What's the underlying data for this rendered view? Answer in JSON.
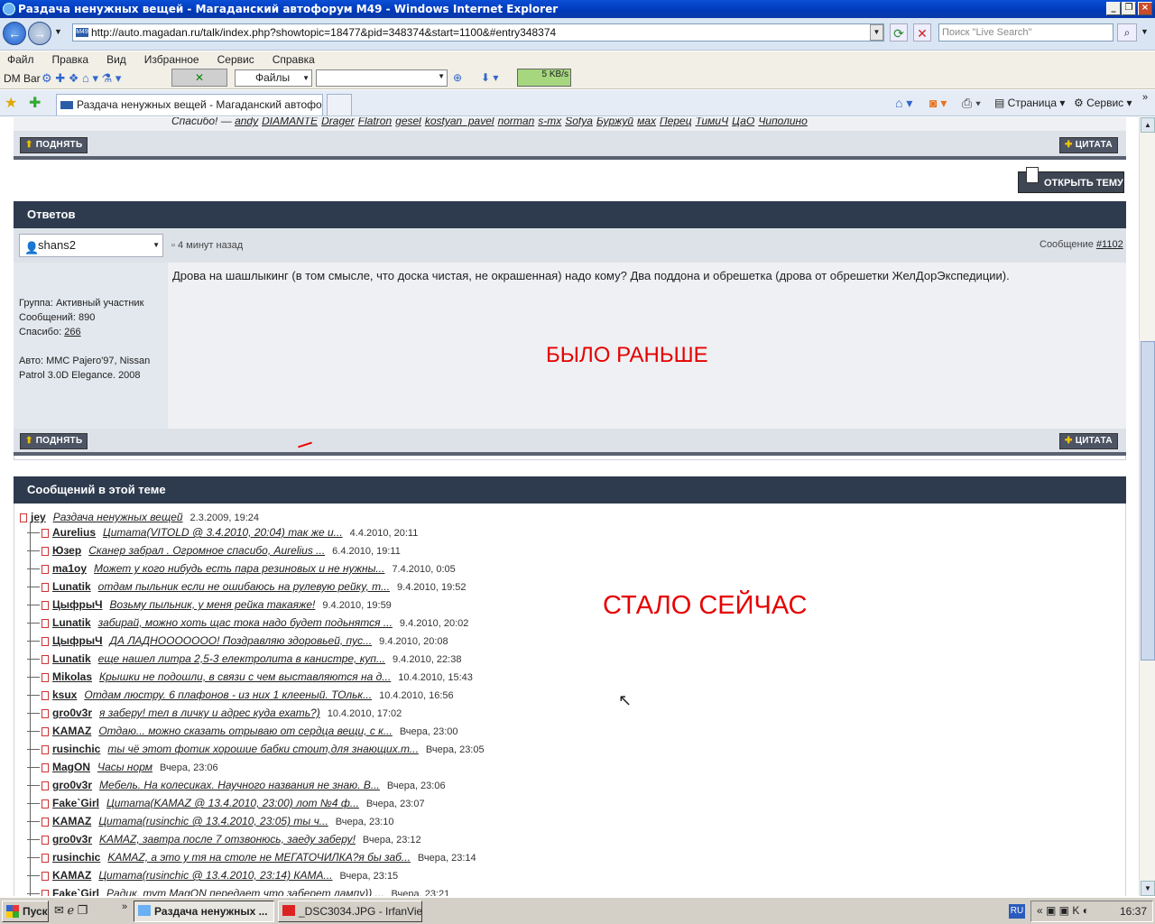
{
  "window": {
    "title": "Раздача ненужных вещей - Магаданский автофорум M49 - Windows Internet Explorer"
  },
  "address": {
    "url": "http://auto.magadan.ru/talk/index.php?showtopic=18477&pid=348374&start=1100&#entry348374",
    "favicon": "M49"
  },
  "search": {
    "placeholder": "Поиск \"Live Search\""
  },
  "menu": [
    "Файл",
    "Правка",
    "Вид",
    "Избранное",
    "Сервис",
    "Справка"
  ],
  "dmbar": {
    "label": "DM Bar",
    "files": "Файлы",
    "speed": "5 KB/s"
  },
  "tab": {
    "title": "Раздача ненужных вещей - Магаданский автофор..."
  },
  "cmdbar": {
    "page": "Страница",
    "service": "Сервис"
  },
  "thanks": {
    "prefix": "Спасибо! —",
    "users": [
      "andy",
      "DIAMANTE",
      "Drager",
      "Flatron",
      "gesel",
      "kostyan_pavel",
      "norman",
      "s-mx",
      "Sofya",
      "Буржуй",
      "мах",
      "Перец",
      "ТимиЧ",
      "ЦаО",
      "Чиполино"
    ]
  },
  "buttons": {
    "up": "ПОДНЯТЬ",
    "quote": "ЦИТАТА",
    "open_topic": "ОТКРЫТЬ ТЕМУ"
  },
  "reply_section": {
    "title": "Ответов"
  },
  "post": {
    "author": "shans2",
    "time": "4 минут назад",
    "msg_label": "Сообщение",
    "msg_num": "#1102",
    "group": "Группа: Активный участник",
    "messages": "Сообщений: 890",
    "thanks_label": "Спасибо:",
    "thanks_count": "266",
    "auto": "Авто: ММС Pajero'97, Nissan Patrol 3.0D Elegance. 2008",
    "text": "Дрова на шашлыкинг (в том смысле, что доска чистая, не окрашенная) надо кому? Два поддона и обрешетка (дрова от обрешетки ЖелДорЭкспедиции).",
    "annotation": "БЫЛО РАНЬШЕ"
  },
  "topic_section": {
    "title": "Сообщений в этой теме",
    "annotation": "СТАЛО СЕЙЧАС"
  },
  "root": {
    "author": "jey",
    "link": "Раздача ненужных вещей",
    "date": "2.3.2009, 19:24"
  },
  "topic_rows": [
    {
      "author": "Aurelius",
      "link": "Цитата(VITOLD @ 3.4.2010, 20:04) так же и...",
      "date": "4.4.2010, 20:11"
    },
    {
      "author": "Юзер",
      "link": "Сканер забрал . Огромное спасибо, Aurelius ...",
      "date": "6.4.2010, 19:11"
    },
    {
      "author": "ma1oy",
      "link": "Может у кого нибудь есть пара резиновых и не нужны...",
      "date": "7.4.2010, 0:05"
    },
    {
      "author": "Lunatik",
      "link": "отдам пыльник если не ошибаюсь на рулевую рейку, т...",
      "date": "9.4.2010, 19:52"
    },
    {
      "author": "ЦыфрыЧ",
      "link": "Возьму пыльник, у меня рейка такаяже!",
      "date": "9.4.2010, 19:59"
    },
    {
      "author": "Lunatik",
      "link": "забирай, можно хоть щас тока надо будет подьнятся ...",
      "date": "9.4.2010, 20:02"
    },
    {
      "author": "ЦыфрыЧ",
      "link": "ДА ЛАДНООООООО! Поздравляю здоровьей, пус...",
      "date": "9.4.2010, 20:08"
    },
    {
      "author": "Lunatik",
      "link": "еще нашел литра 2,5-3 електролита в канистре, куп...",
      "date": "9.4.2010, 22:38"
    },
    {
      "author": "Mikolas",
      "link": "Крышки не подошли, в связи с чем выставляются на д...",
      "date": "10.4.2010, 15:43"
    },
    {
      "author": "ksux",
      "link": "Отдам люстру. 6 плафонов - из них 1 клееный. ТОльк...",
      "date": "10.4.2010, 16:56"
    },
    {
      "author": "gro0v3r",
      "link": "я заберу! тел в личку и адрес куда ехать?)",
      "date": "10.4.2010, 17:02"
    },
    {
      "author": "KAMAZ",
      "link": "Отдаю... можно сказать отрываю от сердца вещи, с к...",
      "date": "Вчера, 23:00"
    },
    {
      "author": "rusinchic",
      "link": "ты чё этот фотик хорошие бабки стоит,для знающих.т...",
      "date": "Вчера, 23:05"
    },
    {
      "author": "MagON",
      "link": "Часы норм",
      "date": "Вчера, 23:06"
    },
    {
      "author": "gro0v3r",
      "link": "Мебель. На колесиках. Научного названия не знаю. В...",
      "date": "Вчера, 23:06"
    },
    {
      "author": "Fake`Girl",
      "link": "Цитата(KAMAZ @ 13.4.2010, 23:00) лот №4 ф...",
      "date": "Вчера, 23:07"
    },
    {
      "author": "KAMAZ",
      "link": "Цитата(rusinchic @ 13.4.2010, 23:05) ты ч...",
      "date": "Вчера, 23:10"
    },
    {
      "author": "gro0v3r",
      "link": "KAMAZ, завтра после 7 отзвонюсь, заеду заберу!",
      "date": "Вчера, 23:12"
    },
    {
      "author": "rusinchic",
      "link": "KAMAZ, а это у тя на столе не МЕГАТОЧИЛКА?я бы заб...",
      "date": "Вчера, 23:14"
    },
    {
      "author": "KAMAZ",
      "link": "Цитата(rusinchic @ 13.4.2010, 23:14) КАМА...",
      "date": "Вчера, 23:15"
    },
    {
      "author": "Fake`Girl",
      "link": "Радик, тут MagON передает что заберет лампу)) ...",
      "date": "Вчера, 23:21"
    }
  ],
  "taskbar": {
    "start": "Пуск",
    "items": [
      "Раздача ненужных ...",
      "_DSC3034.JPG - IrfanVie..."
    ],
    "lang": "RU",
    "clock": "16:37"
  }
}
